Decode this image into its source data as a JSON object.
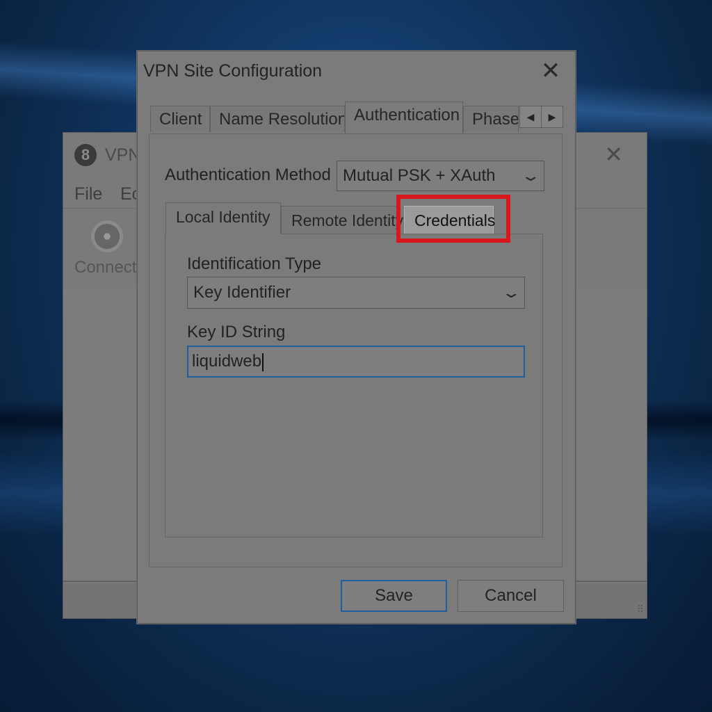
{
  "background_window": {
    "title": "VPN",
    "menu": [
      "File",
      "Ec"
    ],
    "toolbar_connect_label": "Connect"
  },
  "dialog": {
    "title": "VPN Site Configuration",
    "tabs": [
      {
        "label": "Client"
      },
      {
        "label": "Name Resolution"
      },
      {
        "label": "Authentication"
      },
      {
        "label": "Phase"
      }
    ],
    "authentication": {
      "method_label": "Authentication Method",
      "method_value": "Mutual PSK + XAuth",
      "subtabs": [
        {
          "label": "Local Identity"
        },
        {
          "label": "Remote Identity"
        },
        {
          "label": "Credentials"
        }
      ],
      "identification_type_label": "Identification Type",
      "identification_type_value": "Key Identifier",
      "key_id_label": "Key ID String",
      "key_id_value": "liquidweb"
    },
    "buttons": {
      "save": "Save",
      "cancel": "Cancel"
    }
  },
  "highlight_color": "#d8161b"
}
